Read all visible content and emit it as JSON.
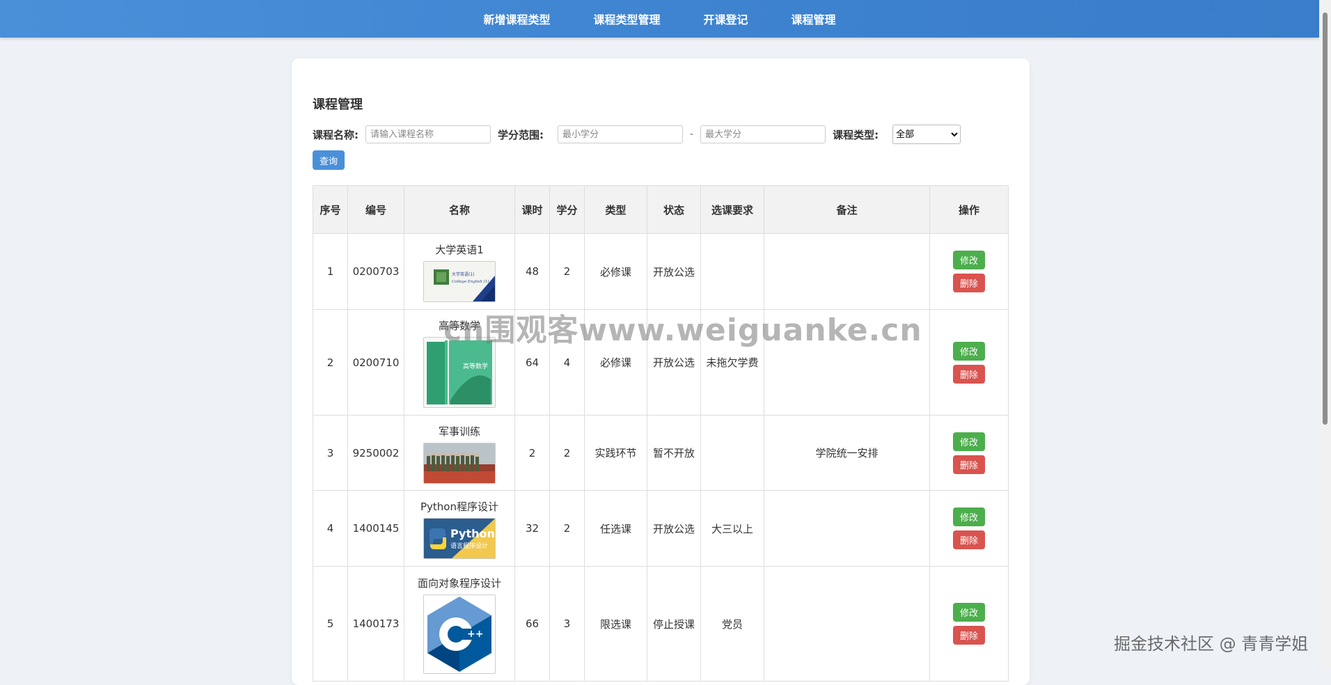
{
  "nav": {
    "items": [
      "新增课程类型",
      "课程类型管理",
      "开课登记",
      "课程管理"
    ]
  },
  "page": {
    "title": "课程管理"
  },
  "filters": {
    "name_label": "课程名称:",
    "name_placeholder": "请输入课程名称",
    "credit_label": "学分范围:",
    "credit_min_placeholder": "最小学分",
    "credit_sep": "-",
    "credit_max_placeholder": "最大学分",
    "type_label": "课程类型:",
    "type_selected": "全部",
    "query_button": "查询"
  },
  "table": {
    "headers": {
      "seq": "序号",
      "code": "编号",
      "name": "名称",
      "hours": "课时",
      "credit": "学分",
      "type": "类型",
      "status": "状态",
      "req": "选课要求",
      "remark": "备注",
      "ops": "操作"
    },
    "rows": [
      {
        "seq": "1",
        "code": "0200703",
        "name": "大学英语1",
        "image": "english-textbook-image",
        "hours": "48",
        "credit": "2",
        "type": "必修课",
        "status": "开放公选",
        "req": "",
        "remark": "",
        "edit": "修改",
        "del": "删除"
      },
      {
        "seq": "2",
        "code": "0200710",
        "name": "高等数学",
        "image": "math-textbook-image",
        "hours": "64",
        "credit": "4",
        "type": "必修课",
        "status": "开放公选",
        "req": "未拖欠学费",
        "remark": "",
        "edit": "修改",
        "del": "删除"
      },
      {
        "seq": "3",
        "code": "9250002",
        "name": "军事训练",
        "image": "military-training-image",
        "hours": "2",
        "credit": "2",
        "type": "实践环节",
        "status": "暂不开放",
        "req": "",
        "remark": "学院统一安排",
        "edit": "修改",
        "del": "删除"
      },
      {
        "seq": "4",
        "code": "1400145",
        "name": "Python程序设计",
        "image": "python-logo-image",
        "hours": "32",
        "credit": "2",
        "type": "任选课",
        "status": "开放公选",
        "req": "大三以上",
        "remark": "",
        "edit": "修改",
        "del": "删除"
      },
      {
        "seq": "5",
        "code": "1400173",
        "name": "面向对象程序设计",
        "image": "cpp-logo-image",
        "hours": "66",
        "credit": "3",
        "type": "限选课",
        "status": "停止授课",
        "req": "党员",
        "remark": "",
        "edit": "修改",
        "del": "删除"
      }
    ]
  },
  "images": {
    "english_cover_title": "大学英语(1)",
    "english_cover_subtitle": "College English (1)",
    "math_cover_title": "高等数学",
    "python_logo_text": "Python",
    "python_logo_subtext": "语言程序设计",
    "cpp_logo_text": "++"
  },
  "watermarks": {
    "center": "cn围观客www.weiguanke.cn",
    "corner": "掘金技术社区 @ 青青学姐"
  },
  "colors": {
    "nav_bg": "#4a90d9",
    "edit_button": "#4cae4c",
    "delete_button": "#d9534f",
    "query_button": "#4a90d9"
  }
}
